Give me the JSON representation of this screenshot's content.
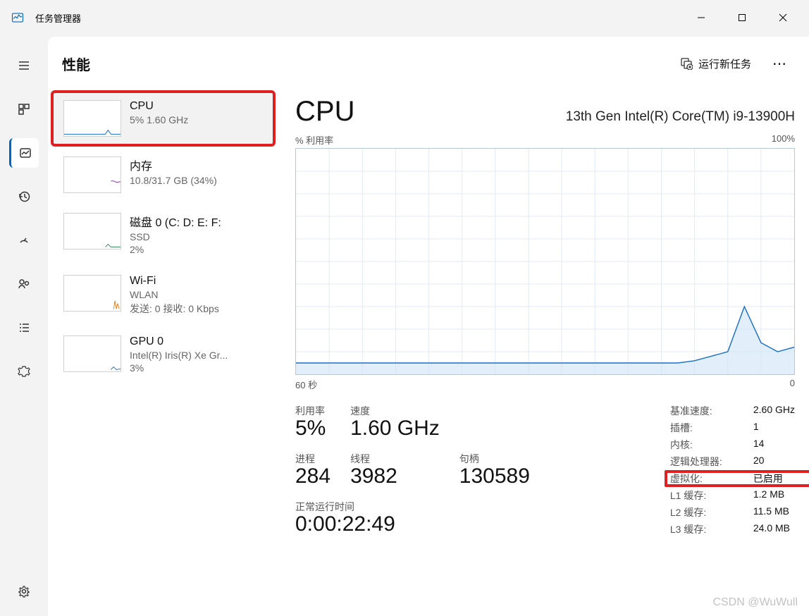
{
  "app": {
    "title": "任务管理器"
  },
  "header": {
    "title": "性能",
    "run_task": "运行新任务",
    "more": "⋯"
  },
  "sidebar": {
    "items": [
      {
        "name": "CPU",
        "sub1": "5%  1.60 GHz"
      },
      {
        "name": "内存",
        "sub1": "10.8/31.7 GB (34%)"
      },
      {
        "name": "磁盘 0 (C: D: E: F:",
        "sub1": "SSD",
        "sub2": "2%"
      },
      {
        "name": "Wi-Fi",
        "sub1": "WLAN",
        "sub2": "发送: 0 接收: 0 Kbps"
      },
      {
        "name": "GPU 0",
        "sub1": "Intel(R) Iris(R) Xe Gr...",
        "sub2": "3%"
      }
    ]
  },
  "detail": {
    "title": "CPU",
    "model": "13th Gen Intel(R) Core(TM) i9-13900H",
    "graph_top_left": "% 利用率",
    "graph_top_right": "100%",
    "graph_bottom_left": "60 秒",
    "graph_bottom_right": "0",
    "stats": {
      "util_label": "利用率",
      "util_value": "5%",
      "speed_label": "速度",
      "speed_value": "1.60 GHz",
      "proc_label": "进程",
      "proc_value": "284",
      "thread_label": "线程",
      "thread_value": "3982",
      "handle_label": "句柄",
      "handle_value": "130589",
      "uptime_label": "正常运行时间",
      "uptime_value": "0:00:22:49"
    },
    "specs": {
      "base_speed_l": "基准速度:",
      "base_speed_v": "2.60 GHz",
      "sockets_l": "插槽:",
      "sockets_v": "1",
      "cores_l": "内核:",
      "cores_v": "14",
      "logical_l": "逻辑处理器:",
      "logical_v": "20",
      "virt_l": "虚拟化:",
      "virt_v": "已启用",
      "l1_l": "L1 缓存:",
      "l1_v": "1.2 MB",
      "l2_l": "L2 缓存:",
      "l2_v": "11.5 MB",
      "l3_l": "L3 缓存:",
      "l3_v": "24.0 MB"
    }
  },
  "watermark": "CSDN @WuWull",
  "chart_data": {
    "type": "line",
    "title": "% 利用率",
    "xlabel": "60 秒",
    "ylabel": "% 利用率",
    "ylim": [
      0,
      100
    ],
    "x": [
      0,
      2,
      4,
      6,
      8,
      10,
      12,
      14,
      16,
      18,
      20,
      22,
      24,
      26,
      28,
      30,
      32,
      34,
      36,
      38,
      40,
      42,
      44,
      46,
      48,
      50,
      52,
      54,
      56,
      58,
      60
    ],
    "values": [
      5,
      5,
      5,
      5,
      5,
      5,
      5,
      5,
      5,
      5,
      5,
      5,
      5,
      5,
      5,
      5,
      5,
      5,
      5,
      5,
      5,
      5,
      5,
      5,
      6,
      8,
      10,
      30,
      14,
      10,
      12
    ]
  }
}
